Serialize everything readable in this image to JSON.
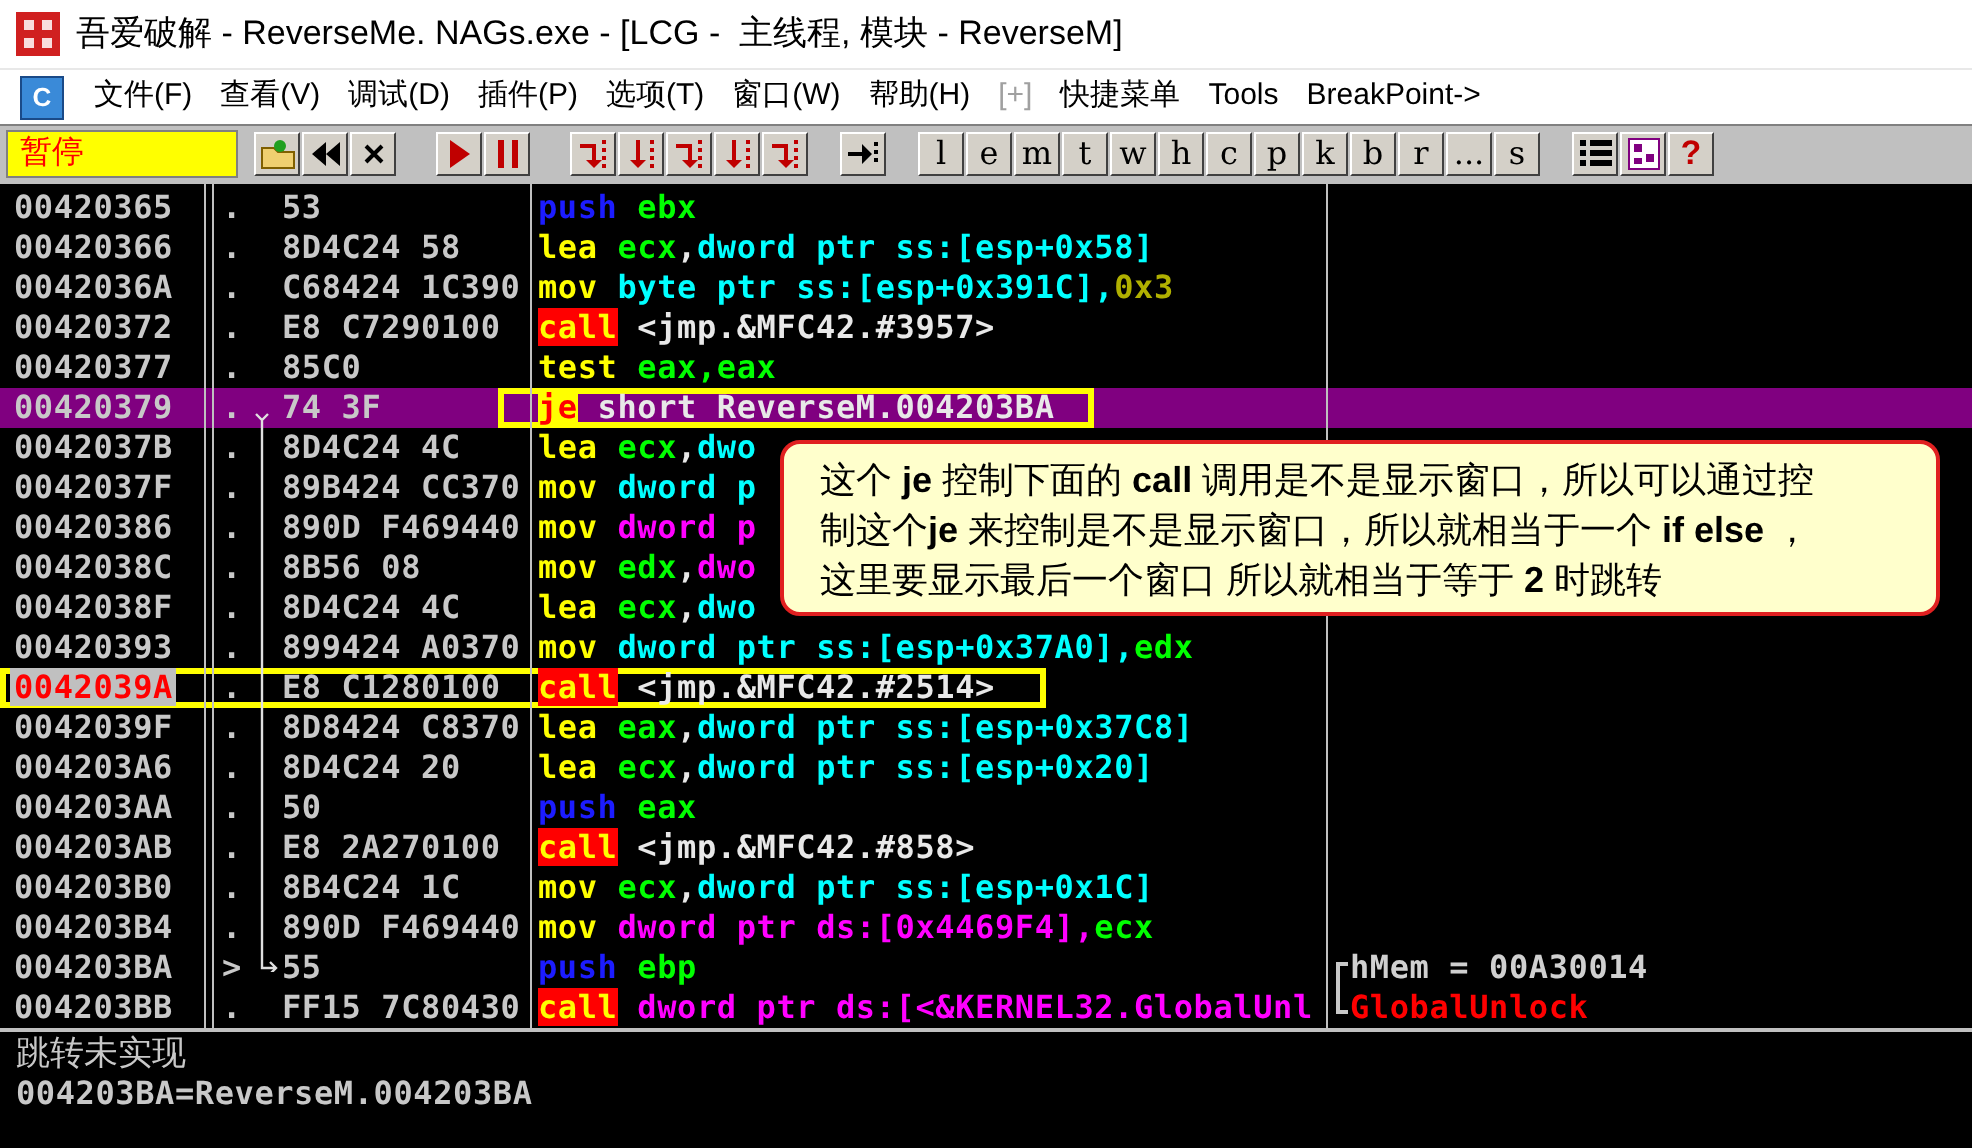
{
  "window": {
    "title": "吾爱破解 - ReverseMe. NAGs.exe - [LCG -  主线程, 模块 - ReverseM]"
  },
  "menu": {
    "app_icon_letter": "C",
    "items": [
      {
        "label": "文件(F)",
        "disabled": false
      },
      {
        "label": "查看(V)",
        "disabled": false
      },
      {
        "label": "调试(D)",
        "disabled": false
      },
      {
        "label": "插件(P)",
        "disabled": false
      },
      {
        "label": "选项(T)",
        "disabled": false
      },
      {
        "label": "窗口(W)",
        "disabled": false
      },
      {
        "label": "帮助(H)",
        "disabled": false
      },
      {
        "label": "[+]",
        "disabled": true
      },
      {
        "label": "快捷菜单",
        "disabled": false
      },
      {
        "label": "Tools",
        "disabled": false
      },
      {
        "label": "BreakPoint->",
        "disabled": false
      }
    ]
  },
  "toolbar": {
    "status": "暂停",
    "letter_buttons": [
      "l",
      "e",
      "m",
      "t",
      "w",
      "h",
      "c",
      "p",
      "k",
      "b",
      "r",
      "...",
      "s"
    ],
    "help_button": "?"
  },
  "disassembly": {
    "rows": [
      {
        "address": "00420365",
        "marker": ".",
        "hex": "53",
        "selected": false,
        "breakpoint": false,
        "tokens": [
          {
            "kind": "stack",
            "text": "push"
          },
          {
            "kind": "register",
            "text": " ebx"
          }
        ]
      },
      {
        "address": "00420366",
        "marker": ".",
        "hex": "8D4C24 58",
        "selected": false,
        "breakpoint": false,
        "tokens": [
          {
            "kind": "mnemonic",
            "text": "lea"
          },
          {
            "kind": "register",
            "text": " ecx"
          },
          {
            "kind": "plain",
            "text": ","
          },
          {
            "kind": "ss_memory",
            "text": "dword ptr ss:[esp+0x58]"
          }
        ]
      },
      {
        "address": "0042036A",
        "marker": ".",
        "hex": "C68424 1C390",
        "selected": false,
        "breakpoint": false,
        "tokens": [
          {
            "kind": "mnemonic",
            "text": "mov"
          },
          {
            "kind": "ss_memory",
            "text": " byte ptr ss:[esp+0x391C],"
          },
          {
            "kind": "constant",
            "text": "0x3"
          }
        ]
      },
      {
        "address": "00420372",
        "marker": ".",
        "hex": "E8 C7290100",
        "selected": false,
        "breakpoint": false,
        "tokens": [
          {
            "kind": "call",
            "text": "call"
          },
          {
            "kind": "plain",
            "text": " <jmp.&MFC42.#3957>"
          }
        ]
      },
      {
        "address": "00420377",
        "marker": ".",
        "hex": "85C0",
        "selected": false,
        "breakpoint": false,
        "tokens": [
          {
            "kind": "mnemonic",
            "text": "test"
          },
          {
            "kind": "register",
            "text": " eax,eax"
          }
        ]
      },
      {
        "address": "00420379",
        "marker": ".",
        "hex": "74 3F",
        "selected": true,
        "breakpoint": false,
        "tokens": [
          {
            "kind": "jump",
            "text": "je"
          },
          {
            "kind": "plain",
            "text": " short ReverseM.004203BA"
          }
        ]
      },
      {
        "address": "0042037B",
        "marker": ".",
        "hex": "8D4C24 4C",
        "selected": false,
        "breakpoint": false,
        "tokens": [
          {
            "kind": "mnemonic",
            "text": "lea"
          },
          {
            "kind": "register",
            "text": " ecx"
          },
          {
            "kind": "plain",
            "text": ","
          },
          {
            "kind": "ss_memory",
            "text": "dwo"
          }
        ]
      },
      {
        "address": "0042037F",
        "marker": ".",
        "hex": "89B424 CC370",
        "selected": false,
        "breakpoint": false,
        "tokens": [
          {
            "kind": "mnemonic",
            "text": "mov"
          },
          {
            "kind": "ss_memory",
            "text": " dword p"
          }
        ]
      },
      {
        "address": "00420386",
        "marker": ".",
        "hex": "890D F469440",
        "selected": false,
        "breakpoint": false,
        "tokens": [
          {
            "kind": "mnemonic",
            "text": "mov"
          },
          {
            "kind": "ds_memory",
            "text": " dword p"
          }
        ]
      },
      {
        "address": "0042038C",
        "marker": ".",
        "hex": "8B56 08",
        "selected": false,
        "breakpoint": false,
        "tokens": [
          {
            "kind": "mnemonic",
            "text": "mov"
          },
          {
            "kind": "register",
            "text": " edx"
          },
          {
            "kind": "plain",
            "text": ","
          },
          {
            "kind": "ds_memory",
            "text": "dwo"
          }
        ]
      },
      {
        "address": "0042038F",
        "marker": ".",
        "hex": "8D4C24 4C",
        "selected": false,
        "breakpoint": false,
        "tokens": [
          {
            "kind": "mnemonic",
            "text": "lea"
          },
          {
            "kind": "register",
            "text": " ecx"
          },
          {
            "kind": "plain",
            "text": ","
          },
          {
            "kind": "ss_memory",
            "text": "dwo"
          }
        ]
      },
      {
        "address": "00420393",
        "marker": ".",
        "hex": "899424 A0370",
        "selected": false,
        "breakpoint": false,
        "tokens": [
          {
            "kind": "mnemonic",
            "text": "mov"
          },
          {
            "kind": "ss_memory",
            "text": " dword ptr ss:[esp+0x37A0],"
          },
          {
            "kind": "register",
            "text": "edx"
          }
        ]
      },
      {
        "address": "0042039A",
        "marker": ".",
        "hex": "E8 C1280100",
        "selected": false,
        "breakpoint": true,
        "tokens": [
          {
            "kind": "call",
            "text": "call"
          },
          {
            "kind": "plain",
            "text": " <jmp.&MFC42.#2514>"
          }
        ]
      },
      {
        "address": "0042039F",
        "marker": ".",
        "hex": "8D8424 C8370",
        "selected": false,
        "breakpoint": false,
        "tokens": [
          {
            "kind": "mnemonic",
            "text": "lea"
          },
          {
            "kind": "register",
            "text": " eax"
          },
          {
            "kind": "plain",
            "text": ","
          },
          {
            "kind": "ss_memory",
            "text": "dword ptr ss:[esp+0x37C8]"
          }
        ]
      },
      {
        "address": "004203A6",
        "marker": ".",
        "hex": "8D4C24 20",
        "selected": false,
        "breakpoint": false,
        "tokens": [
          {
            "kind": "mnemonic",
            "text": "lea"
          },
          {
            "kind": "register",
            "text": " ecx"
          },
          {
            "kind": "plain",
            "text": ","
          },
          {
            "kind": "ss_memory",
            "text": "dword ptr ss:[esp+0x20]"
          }
        ]
      },
      {
        "address": "004203AA",
        "marker": ".",
        "hex": "50",
        "selected": false,
        "breakpoint": false,
        "tokens": [
          {
            "kind": "stack",
            "text": "push"
          },
          {
            "kind": "register",
            "text": " eax"
          }
        ]
      },
      {
        "address": "004203AB",
        "marker": ".",
        "hex": "E8 2A270100",
        "selected": false,
        "breakpoint": false,
        "tokens": [
          {
            "kind": "call",
            "text": "call"
          },
          {
            "kind": "plain",
            "text": " <jmp.&MFC42.#858>"
          }
        ]
      },
      {
        "address": "004203B0",
        "marker": ".",
        "hex": "8B4C24 1C",
        "selected": false,
        "breakpoint": false,
        "tokens": [
          {
            "kind": "mnemonic",
            "text": "mov"
          },
          {
            "kind": "register",
            "text": " ecx"
          },
          {
            "kind": "plain",
            "text": ","
          },
          {
            "kind": "ss_memory",
            "text": "dword ptr ss:[esp+0x1C]"
          }
        ]
      },
      {
        "address": "004203B4",
        "marker": ".",
        "hex": "890D F469440",
        "selected": false,
        "breakpoint": false,
        "tokens": [
          {
            "kind": "mnemonic",
            "text": "mov"
          },
          {
            "kind": "ds_memory",
            "text": " dword ptr ds:[0x4469F4],"
          },
          {
            "kind": "register",
            "text": "ecx"
          }
        ]
      },
      {
        "address": "004203BA",
        "marker": ">",
        "hex": "55",
        "selected": false,
        "breakpoint": false,
        "tokens": [
          {
            "kind": "stack",
            "text": "push"
          },
          {
            "kind": "register",
            "text": " ebp"
          }
        ],
        "comment": {
          "kind": "argument",
          "text": "hMem = 00A30014"
        }
      },
      {
        "address": "004203BB",
        "marker": ".",
        "hex": "FF15 7C80430",
        "selected": false,
        "breakpoint": false,
        "tokens": [
          {
            "kind": "call",
            "text": "call"
          },
          {
            "kind": "ds_memory",
            "text": " dword ptr ds:[<&KERNEL32.GlobalUnl"
          }
        ],
        "comment": {
          "kind": "api",
          "text": "GlobalUnlock"
        }
      }
    ]
  },
  "callout": {
    "text": "这个 **je** 控制下面的 **call** 调用是不是显示窗口，所以可以通过控制这个**je** 来控制是不是显示窗口，所以就相当于一个 **if else** ，这里要显示最后一个窗口 所以就相当于等于 **2** 时跳转"
  },
  "info_pane": {
    "lines": [
      "跳转未实现",
      "004203BA=ReverseM.004203BA"
    ]
  }
}
